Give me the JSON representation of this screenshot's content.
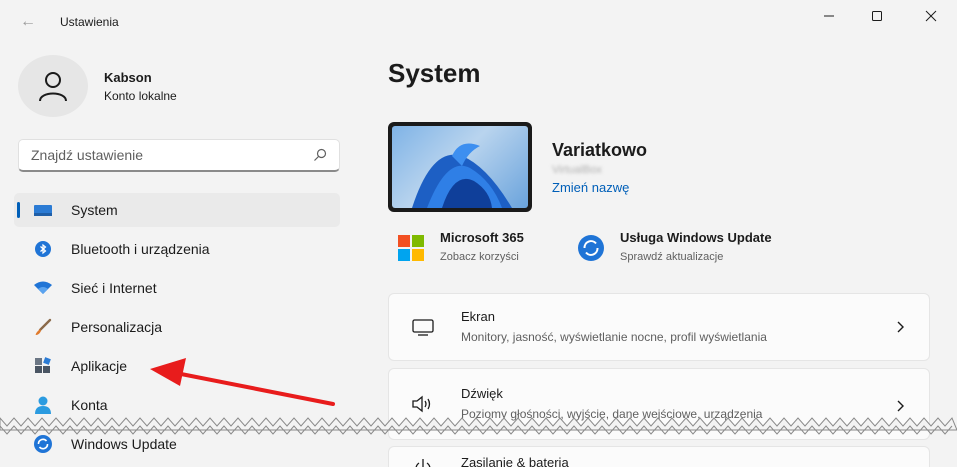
{
  "window": {
    "title": "Ustawienia",
    "back_icon": "arrow-left-icon",
    "controls": [
      "minimize-icon",
      "maximize-icon",
      "close-icon"
    ]
  },
  "profile": {
    "name": "Kabson",
    "account": "Konto lokalne"
  },
  "search": {
    "placeholder": "Znajdź ustawienie"
  },
  "sidebar": {
    "items": [
      {
        "label": "System",
        "icon": "monitor-icon",
        "active": true
      },
      {
        "label": "Bluetooth i urządzenia",
        "icon": "bluetooth-icon"
      },
      {
        "label": "Sieć i Internet",
        "icon": "wifi-icon"
      },
      {
        "label": "Personalizacja",
        "icon": "brush-icon"
      },
      {
        "label": "Aplikacje",
        "icon": "apps-icon"
      },
      {
        "label": "Konta",
        "icon": "person-icon"
      },
      {
        "label": "Windows Update",
        "icon": "update-icon"
      }
    ]
  },
  "main": {
    "title": "System",
    "device": {
      "name": "Variatkowo",
      "model": "VirtualBox",
      "rename_link": "Zmień nazwę"
    },
    "quick_links": [
      {
        "title": "Microsoft 365",
        "subtitle": "Zobacz korzyści",
        "icon": "microsoft-logo-icon"
      },
      {
        "title": "Usługa Windows Update",
        "subtitle": "Sprawdź aktualizacje",
        "icon": "update-icon"
      }
    ],
    "cards": [
      {
        "title": "Ekran",
        "subtitle": "Monitory, jasność, wyświetlanie nocne, profil wyświetlania",
        "icon": "display-icon"
      },
      {
        "title": "Dźwięk",
        "subtitle": "Poziomy głośności, wyjście, dane wejściowe, urządzenia",
        "icon": "speaker-icon"
      },
      {
        "title": "Zasilanie & bateria",
        "subtitle": "",
        "icon": "power-icon"
      }
    ]
  },
  "colors": {
    "accent": "#005fb8",
    "annotation_arrow": "#e81c1c",
    "background": "#f3f3f3"
  }
}
